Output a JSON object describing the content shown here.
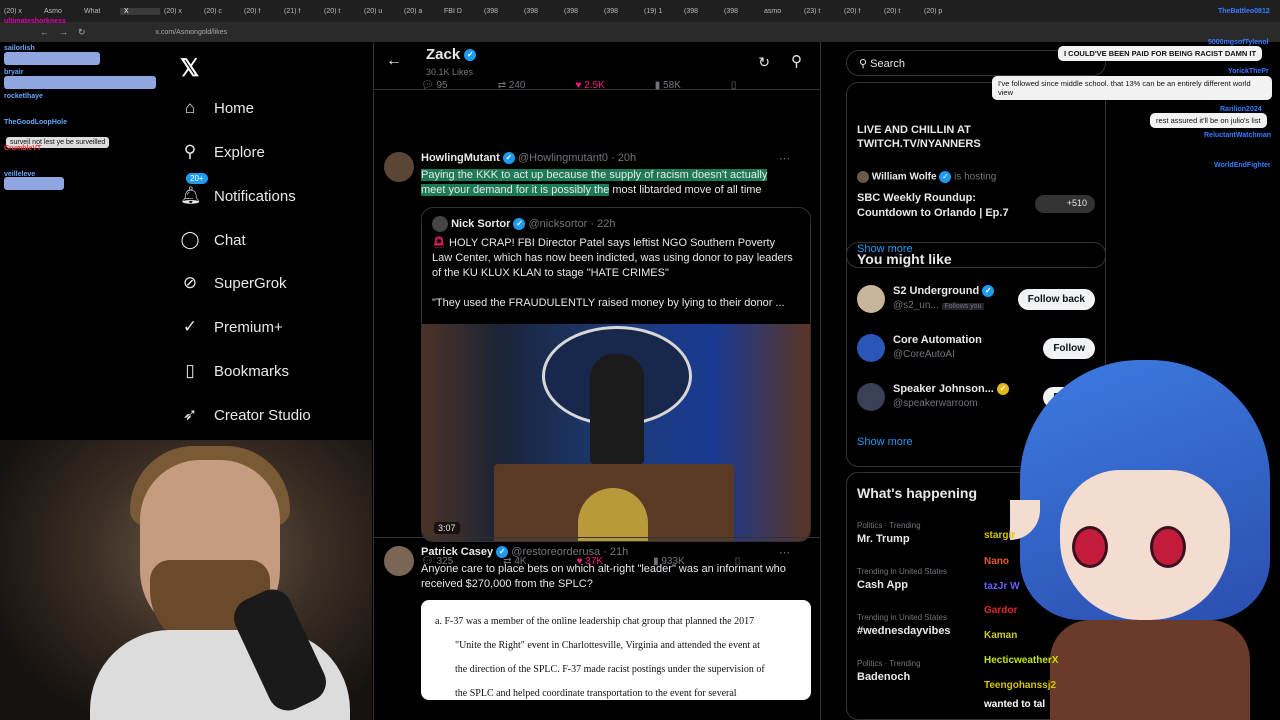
{
  "browser": {
    "tabs": [
      "(20) x",
      "Asmo",
      "What",
      "X",
      "(20) x",
      "(20) c",
      "(20) f",
      "(21) f",
      "(20) t",
      "(20) u",
      "(20) a",
      "FBI D",
      "(398",
      "(398",
      "(398",
      "(398",
      "(19) 1",
      "(398",
      "(398",
      "asmo",
      "(23) t",
      "(20) f",
      "(20) t",
      "(20) p"
    ],
    "url": "x.com/Asmongold/likes"
  },
  "sidebar": {
    "items": [
      {
        "label": "Home",
        "icon": "home-icon"
      },
      {
        "label": "Explore",
        "icon": "search-icon"
      },
      {
        "label": "Notifications",
        "icon": "bell-icon",
        "badge": "20+"
      },
      {
        "label": "Chat",
        "icon": "chat-bubble-icon"
      },
      {
        "label": "SuperGrok",
        "icon": "grok-icon"
      },
      {
        "label": "Premium+",
        "icon": "premium-check-icon"
      },
      {
        "label": "Bookmarks",
        "icon": "bookmark-icon"
      },
      {
        "label": "Creator Studio",
        "icon": "rocket-icon"
      }
    ]
  },
  "timeline": {
    "name": "Zack",
    "likes": "30.1K Likes",
    "top_stats": {
      "replies": "95",
      "reposts": "240",
      "likes": "2.5K",
      "views": "58K"
    },
    "post1": {
      "author": "HowlingMutant",
      "handle": "@Howlingmutant0",
      "time": "20h",
      "text_highlighted": "Paying the KKK to act up because the supply of racism doesn't actually meet your demand for it is possibly the",
      "text_rest": " most libtarded move of all time",
      "quote": {
        "author": "Nick Sortor",
        "handle": "@nicksortor",
        "time": "22h",
        "text": "HOLY CRAP! FBI Director Patel says leftist NGO Southern Poverty Law Center, which has now been indicted, was using donor to pay leaders of the KU KLUX KLAN to stage \"HATE CRIMES\"",
        "text2": "\"They used the FRAUDULENTLY raised money by lying to their donor ...",
        "video_time": "3:07"
      },
      "stats": {
        "replies": "325",
        "reposts": "4K",
        "likes": "37K",
        "views": "933K"
      }
    },
    "post2": {
      "author": "Patrick Casey",
      "handle": "@restoreorderusa",
      "time": "21h",
      "text": "Anyone care to place bets on which alt-right \"leader\" was an informant who received $270,000 from the SPLC?",
      "doc_lines": [
        "a.   F-37 was a member of the online leadership chat group that planned the 2017",
        "\"Unite the Right\" event in Charlottesville, Virginia and attended the event at",
        "the direction of the SPLC.  F-37 made racist postings under the supervision of",
        "the SPLC and helped coordinate transportation to the event for several"
      ]
    }
  },
  "right": {
    "search_placeholder": "Search",
    "live_title": "LIVE AND CHILLIN AT TWITCH.TV/NYANNERS",
    "host_name": "William Wolfe",
    "host_suffix": "is hosting",
    "space_title": "SBC Weekly Roundup: Countdown to Orlando | Ep.7",
    "space_count": "+510",
    "show_more": "Show more",
    "wtf_title": "You might like",
    "wtf": [
      {
        "name": "S2 Underground",
        "handle": "@s2_un...",
        "follows_you": "Follows you",
        "button": "Follow back"
      },
      {
        "name": "Core Automation",
        "handle": "@CoreAutoAI",
        "button": "Follow"
      },
      {
        "name": "Speaker Johnson...",
        "handle": "@speakerwarroom",
        "button": "Follow"
      }
    ],
    "trending_title": "What's happening",
    "trends": [
      {
        "category": "Politics · Trending",
        "name": "Mr. Trump"
      },
      {
        "category": "Trending in United States",
        "name": "Cash App"
      },
      {
        "category": "Trending in United States",
        "name": "#wednesdayvibes"
      },
      {
        "category": "Politics · Trending",
        "name": "Badenoch"
      }
    ]
  },
  "overlay": {
    "left_chat": {
      "users": [
        "ultimateshorkness",
        "sailorlish",
        "bryair",
        "rocketlhaye",
        "TheGoodLoopHole",
        "CrumbleVT",
        "veilleleve"
      ],
      "message": "surveil not lest ye be surveilled"
    },
    "right_chat": {
      "top_user": "TheBattleo0812",
      "bubble1": "I COULD'VE BEEN PAID FOR BEING RACIST DAMN IT",
      "user2": "5000mgsofTylenol",
      "user3": "YorickThePr",
      "bubble2": "I've followed since middle school. that 13% can be an entirely different world view",
      "user4": "Rarilion2024",
      "bubble3": "rest assured it'll be on julio's list",
      "user5": "ReluctantWatchman",
      "user6": "WorldEndFighter",
      "lower_msgs": [
        "stargir",
        "Nano",
        "tazJr W",
        "Gardor",
        "Kaman",
        "HecticweatherX",
        "Teengohanssj2",
        "wanted to tal"
      ]
    }
  }
}
